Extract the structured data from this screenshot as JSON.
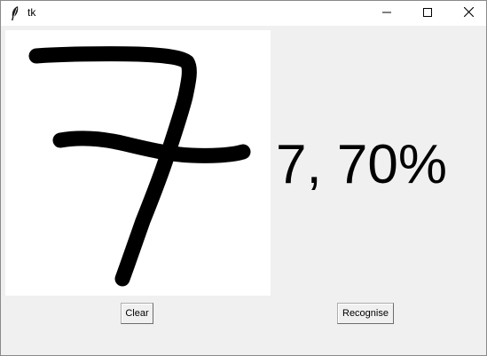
{
  "window": {
    "title": "tk",
    "app_icon": "feather-icon",
    "controls": [
      "minimize-icon",
      "maximize-icon",
      "close-icon"
    ]
  },
  "canvas": {
    "content": "handwritten-digit-seven",
    "background_color": "#ffffff",
    "stroke_color": "#000000"
  },
  "result": {
    "text": "7, 70%"
  },
  "buttons": {
    "clear_label": "Clear",
    "recognise_label": "Recognise"
  }
}
